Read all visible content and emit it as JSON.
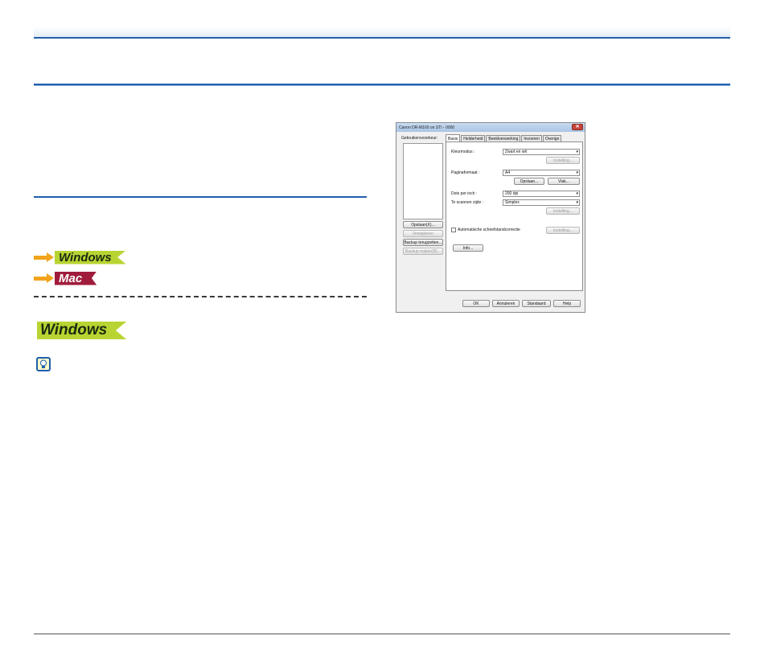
{
  "os_tags": {
    "windows": "Windows",
    "mac": "Mac",
    "windows_heading": "Windows"
  },
  "dialog": {
    "title": "Canon DR-M160 on STI - 0000",
    "close_glyph": "✕",
    "device_list_label": "Gebruikersvoorkeur:",
    "left_buttons": {
      "add": "Opslaan(X)...",
      "delete": "Verwijderen",
      "backup_restore": "Backup terugzetten...",
      "backup_make": "Backup maken(B)..."
    },
    "tabs": [
      "Basis",
      "Helderheid",
      "Beeldverwerking",
      "Invoeren",
      "Overige"
    ],
    "fields": {
      "color_mode_label": "Kleurmodus :",
      "color_mode_value": "Zwart en wit",
      "color_mode_settings": "Instelling...",
      "page_size_label": "Paginaformaat :",
      "page_size_value": "A4",
      "page_size_save": "Opslaan...",
      "page_size_area": "Vlak...",
      "dpi_label": "Dots per inch :",
      "dpi_value": "200 dpi",
      "scan_side_label": "Te scannen zijde :",
      "scan_side_value": "Simplex",
      "scan_side_settings": "Instelling...",
      "auto_resolution_label": "Automatische scheefstandcorrectie",
      "auto_resolution_settings": "Instelling...",
      "info_button": "Info..."
    },
    "bottom_buttons": {
      "ok": "OK",
      "cancel": "Annuleren",
      "default": "Standaard",
      "help": "Help"
    },
    "dropdown_glyph": "▾"
  }
}
